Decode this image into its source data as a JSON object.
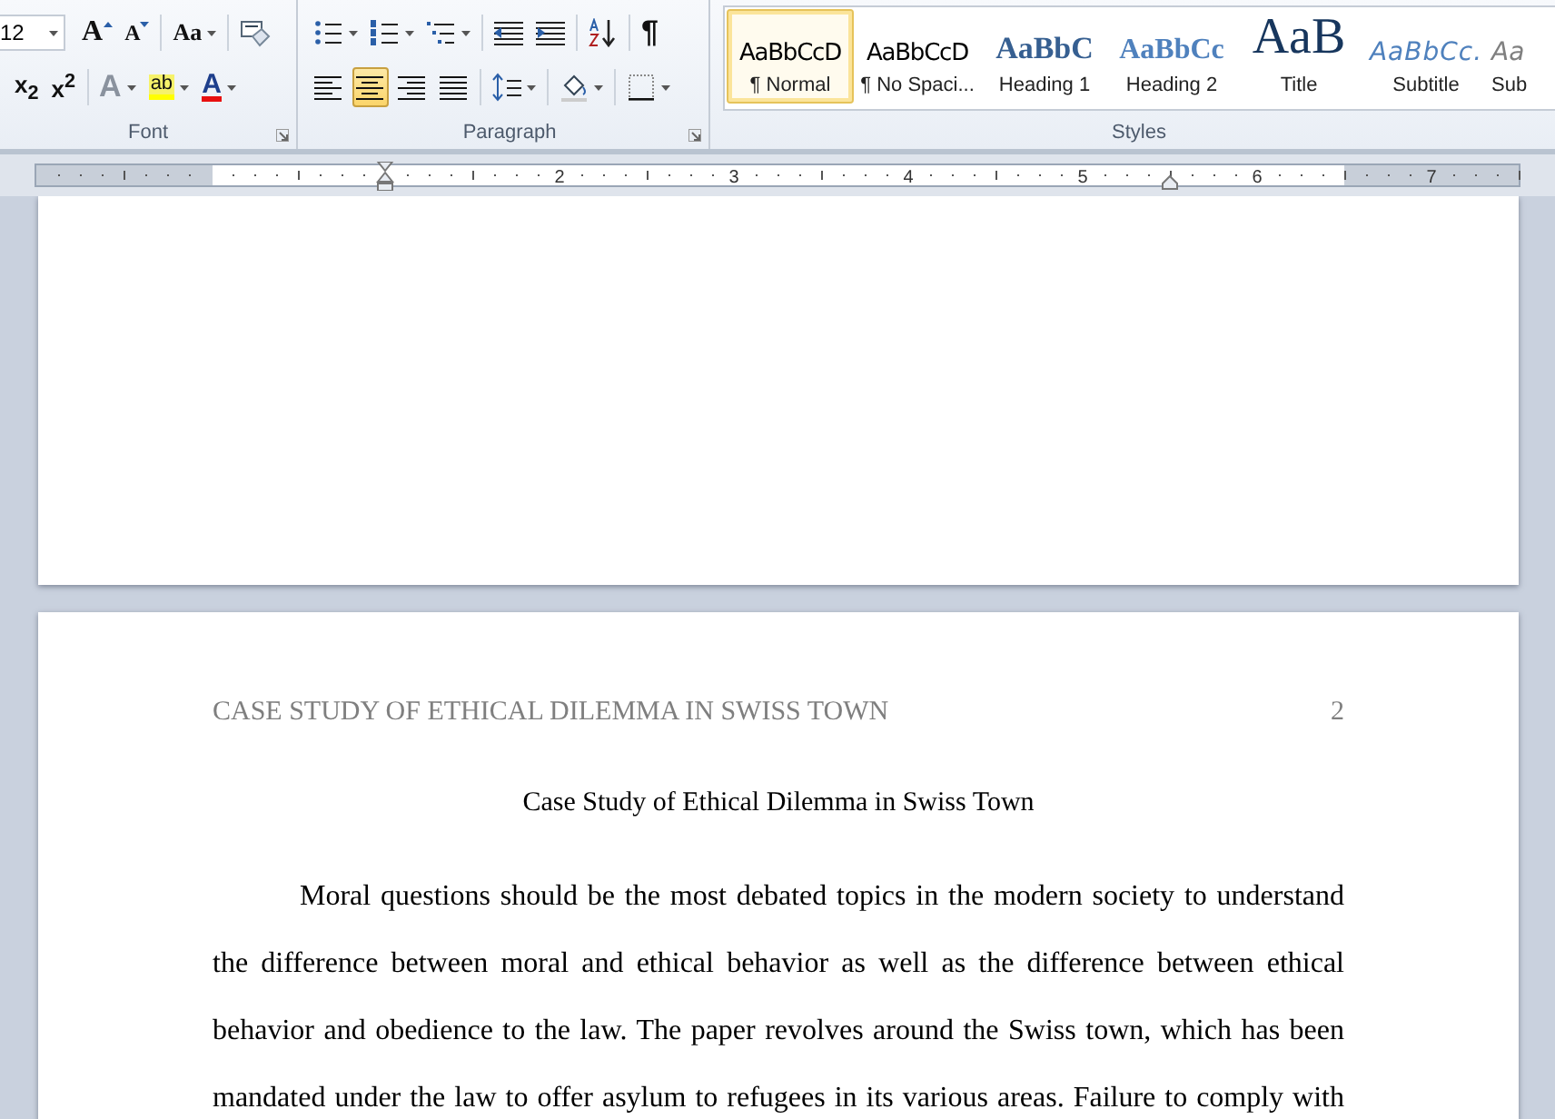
{
  "ribbon": {
    "font": {
      "label": "Font",
      "size": "12",
      "row1": [
        {
          "kind": "grow",
          "glyph": "A"
        },
        {
          "kind": "shrink",
          "glyph": "A"
        },
        {
          "kind": "case",
          "glyph": "Aa"
        },
        {
          "kind": "clear"
        }
      ],
      "row2": [
        {
          "kind": "subscript",
          "glyph": "x$_{2}$"
        },
        {
          "kind": "superscript",
          "glyph": "x$^{2}$"
        },
        {
          "kind": "effects",
          "glyph": "A"
        },
        {
          "kind": "highlight",
          "glyph": "ab"
        },
        {
          "kind": "color",
          "glyph": "A"
        }
      ]
    },
    "paragraph": {
      "label": "Paragraph",
      "row1": [
        {
          "kind": "bullets"
        },
        {
          "kind": "numbering"
        },
        {
          "kind": "multilevel"
        },
        {
          "kind": "outdent"
        },
        {
          "kind": "indent"
        },
        {
          "kind": "sort"
        },
        {
          "kind": "pilcrow",
          "glyph": "¶"
        }
      ],
      "alignment": [
        {
          "kind": "left",
          "selected": false
        },
        {
          "kind": "center",
          "selected": true
        },
        {
          "kind": "right",
          "selected": false
        },
        {
          "kind": "justify",
          "selected": false
        }
      ],
      "row2": [
        {
          "kind": "spacing"
        },
        {
          "kind": "shading"
        },
        {
          "kind": "borders"
        }
      ]
    },
    "styles": {
      "label": "Styles",
      "items": [
        {
          "kind": "normal",
          "preview": "AaBbCcD",
          "label": "¶ Normal",
          "selected": true
        },
        {
          "kind": "normal",
          "preview": "AaBbCcD",
          "label": "¶ No Spaci...",
          "selected": false
        },
        {
          "kind": "heading1",
          "preview": "AaBbC",
          "label": "Heading 1",
          "selected": false
        },
        {
          "kind": "heading2",
          "preview": "AaBbCc",
          "label": "Heading 2",
          "selected": false
        },
        {
          "kind": "title",
          "preview": "AaB",
          "label": "Title",
          "selected": false
        },
        {
          "kind": "subtitle",
          "preview": "AaBbCc.",
          "label": "Subtitle",
          "selected": false
        },
        {
          "kind": "subtle",
          "preview": "Aa",
          "label": "Sub",
          "selected": false
        }
      ]
    }
  },
  "ruler": {
    "numbers": [
      "2",
      "3",
      "4",
      "5",
      "6",
      "7"
    ]
  },
  "document": {
    "header": "CASE STUDY OF ETHICAL DILEMMA IN SWISS TOWN",
    "page_number": "2",
    "title": "Case Study of Ethical Dilemma in Swiss Town",
    "paragraph": "Moral questions should be the most debated topics in the modern society to understand the difference between moral and ethical behavior as well as the difference between ethical behavior and obedience to the law. The paper revolves around the Swiss town, which has been mandated under the law to offer asylum to refugees in its various areas. Failure to comply with"
  }
}
